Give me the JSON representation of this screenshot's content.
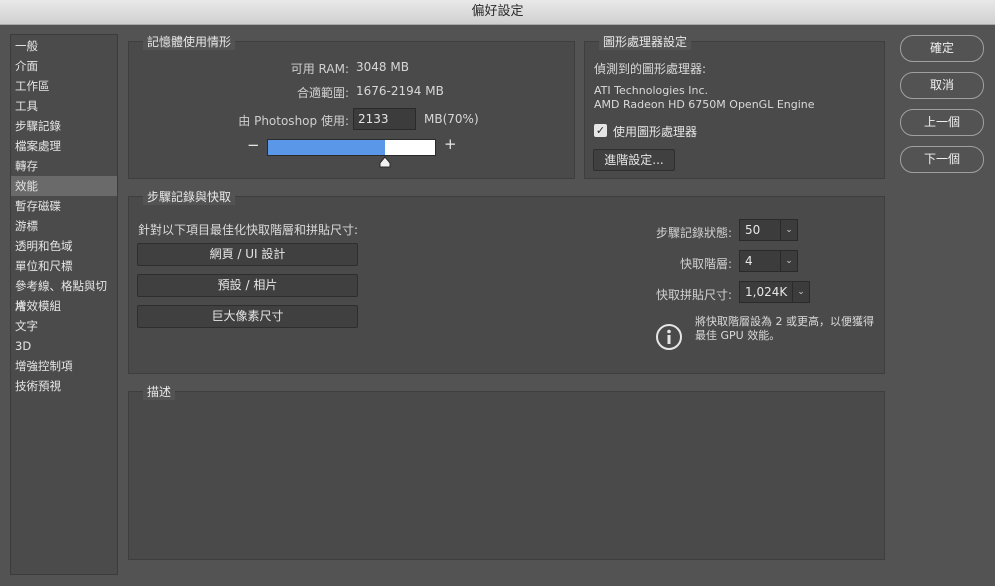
{
  "window": {
    "title": "偏好設定"
  },
  "sidebar": {
    "items": [
      {
        "label": "一般"
      },
      {
        "label": "介面"
      },
      {
        "label": "工作區"
      },
      {
        "label": "工具"
      },
      {
        "label": "步驟記錄"
      },
      {
        "label": "檔案處理"
      },
      {
        "label": "轉存"
      },
      {
        "label": "效能"
      },
      {
        "label": "暫存磁碟"
      },
      {
        "label": "游標"
      },
      {
        "label": "透明和色域"
      },
      {
        "label": "單位和尺標"
      },
      {
        "label": "參考線、格點與切片"
      },
      {
        "label": "增效模組"
      },
      {
        "label": "文字"
      },
      {
        "label": "3D"
      },
      {
        "label": "增強控制項"
      },
      {
        "label": "技術預視"
      }
    ],
    "selected_index": 7
  },
  "memory": {
    "title": "記憶體使用情形",
    "available_label": "可用 RAM:",
    "available_value": "3048 MB",
    "ideal_label": "合適範圍:",
    "ideal_value": "1676-2194 MB",
    "let_use_label": "由 Photoshop 使用:",
    "let_use_value": "2133",
    "let_use_unit": "MB(70%)",
    "minus": "−",
    "plus": "+",
    "slider_fraction": 0.7
  },
  "gpu": {
    "title": "圖形處理器設定",
    "detected_label": "偵測到的圖形處理器:",
    "vendor": "ATI Technologies Inc.",
    "model": "AMD Radeon HD 6750M OpenGL Engine",
    "use_gpu_label": "使用圖形處理器",
    "use_gpu_checked": true,
    "check_mark": "✓",
    "advanced_button": "進階設定..."
  },
  "history": {
    "title": "步驟記錄與快取",
    "optimize_label": "針對以下項目最佳化快取階層和拼貼尺寸:",
    "btn_web": "網頁 / UI 設計",
    "btn_default": "預設 / 相片",
    "btn_huge": "巨大像素尺寸",
    "history_states_label": "步驟記錄狀態:",
    "history_states_value": "50",
    "cache_levels_label": "快取階層:",
    "cache_levels_value": "4",
    "tile_size_label": "快取拼貼尺寸:",
    "tile_size_value": "1,024K",
    "info_line1": "將快取階層設為 2 或更高，以便獲得",
    "info_line2": "最佳 GPU 效能。",
    "chevron": "⌄"
  },
  "description": {
    "title": "描述"
  },
  "buttons": {
    "ok": "確定",
    "cancel": "取消",
    "prev": "上一個",
    "next": "下一個"
  },
  "colors": {
    "accent": "#5b97e8",
    "background": "#535353",
    "panel": "#4a4a4a"
  }
}
